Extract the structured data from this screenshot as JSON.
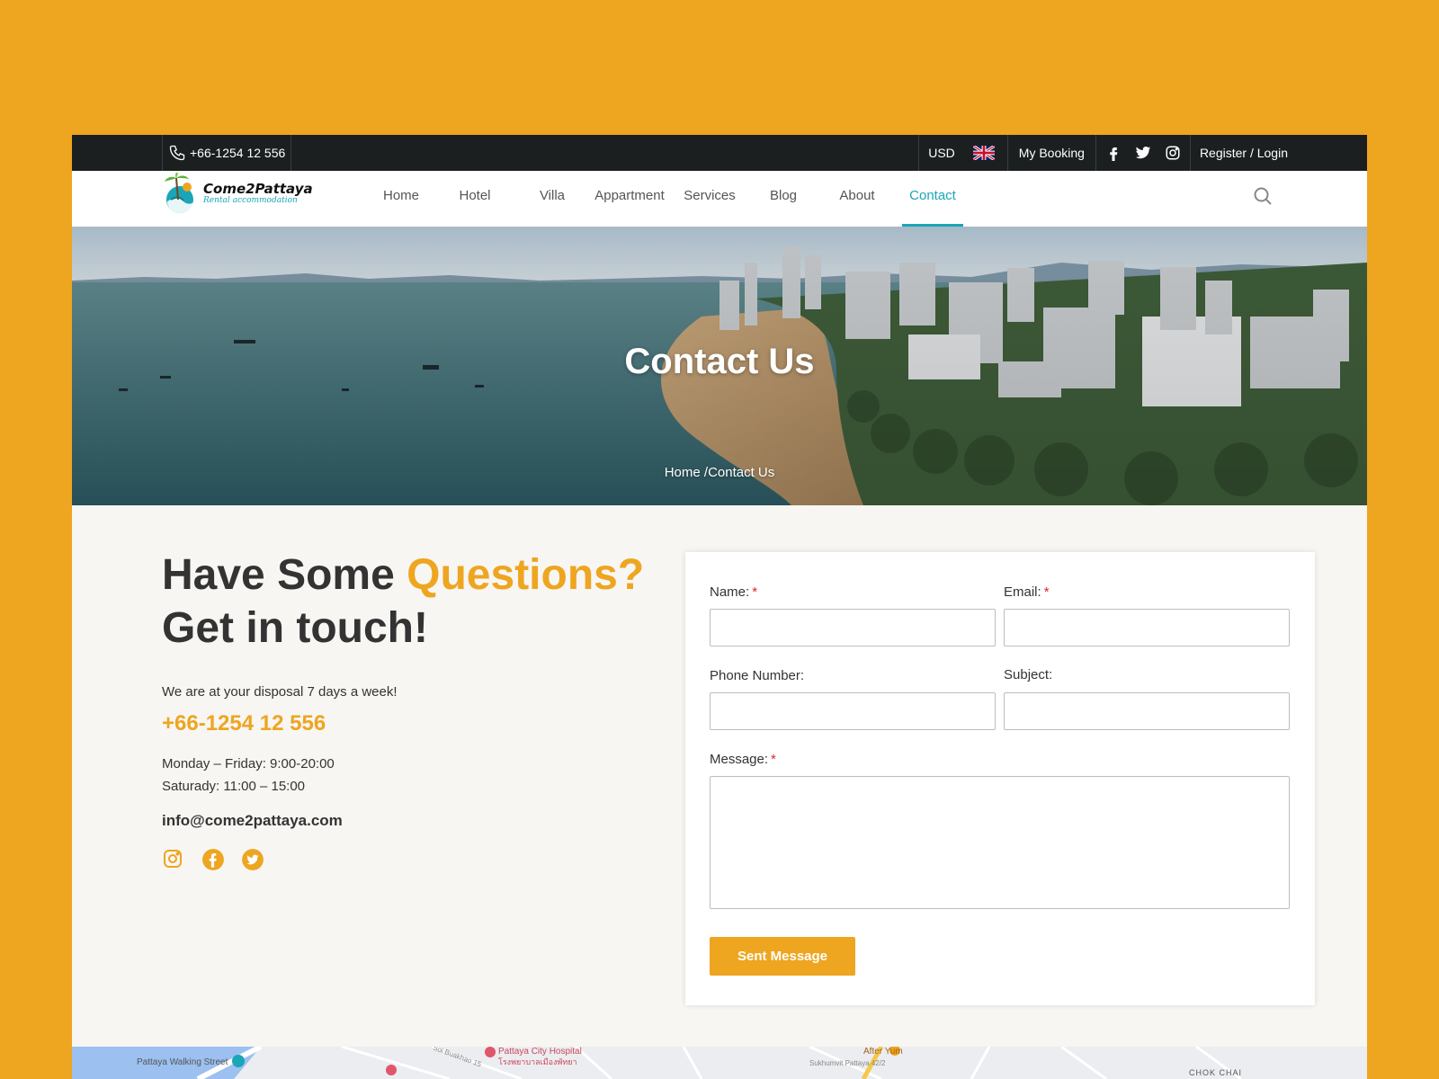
{
  "topbar": {
    "phone": "+66-1254 12 556",
    "currency": "USD",
    "language_flag": "uk-flag-icon",
    "my_booking": "My Booking",
    "social_icons": [
      "facebook-icon",
      "twitter-icon",
      "instagram-icon"
    ],
    "register_login": "Register / Login"
  },
  "nav": {
    "brand": "Come2Pattaya",
    "tagline": "Rental accommodation",
    "items": [
      {
        "label": "Home"
      },
      {
        "label": "Hotel"
      },
      {
        "label": "Villa"
      },
      {
        "label": "Appartment"
      },
      {
        "label": "Services"
      },
      {
        "label": "Blog"
      },
      {
        "label": "About"
      },
      {
        "label": "Contact"
      }
    ],
    "active_item": "Contact",
    "search_icon": "search-icon"
  },
  "hero": {
    "title": "Contact Us",
    "breadcrumb": "Home /Contact Us"
  },
  "contact_info": {
    "heading_part1": "Have Some ",
    "heading_accent": "Questions?",
    "heading_line2": "Get in touch!",
    "disposal": "We are at your disposal 7 days a week!",
    "phone": "+66-1254 12 556",
    "hours_weekdays": "Monday – Friday: 9:00-20:00",
    "hours_saturday": "Saturady: 11:00 – 15:00",
    "email": "info@come2pattaya.com",
    "social_icons": [
      "instagram-icon",
      "facebook-icon",
      "twitter-icon"
    ]
  },
  "form": {
    "name_label": "Name:",
    "email_label": "Email:",
    "phone_label": "Phone Number:",
    "subject_label": "Subject:",
    "message_label": "Message:",
    "required_mark": "*",
    "name_value": "",
    "email_value": "",
    "phone_value": "",
    "subject_value": "",
    "message_value": "",
    "submit_label": "Sent Message"
  },
  "map": {
    "labels": [
      "Pattaya Walking Street",
      "Pattaya City Hospital",
      "โรงพยาบาลเมืองพัทยา",
      "After Yum",
      "Sukhumvit Pattaya 42/2",
      "CHOK CHAI",
      "Soi Buakhao 15"
    ]
  },
  "colors": {
    "accent": "#EEA520",
    "teal": "#1AA6B7",
    "topbar": "#1B1F20",
    "required": "#E02424"
  }
}
